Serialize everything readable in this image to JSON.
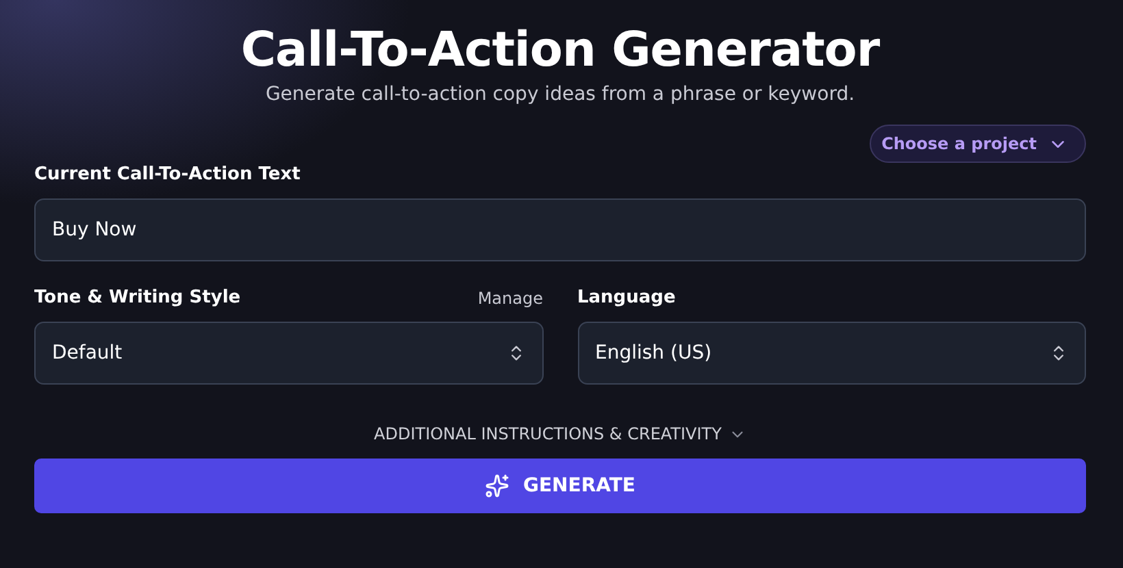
{
  "header": {
    "title": "Call-To-Action Generator",
    "subtitle": "Generate call-to-action copy ideas from a phrase or keyword."
  },
  "project_picker": {
    "label": "Choose a project"
  },
  "cta_field": {
    "label": "Current Call-To-Action Text",
    "value": "Buy Now"
  },
  "tone": {
    "label": "Tone & Writing Style",
    "action": "Manage",
    "value": "Default"
  },
  "language": {
    "label": "Language",
    "value": "English (US)"
  },
  "additional": {
    "label": "ADDITIONAL INSTRUCTIONS & CREATIVITY",
    "expanded": false
  },
  "generate_button": {
    "label": "GENERATE"
  }
}
